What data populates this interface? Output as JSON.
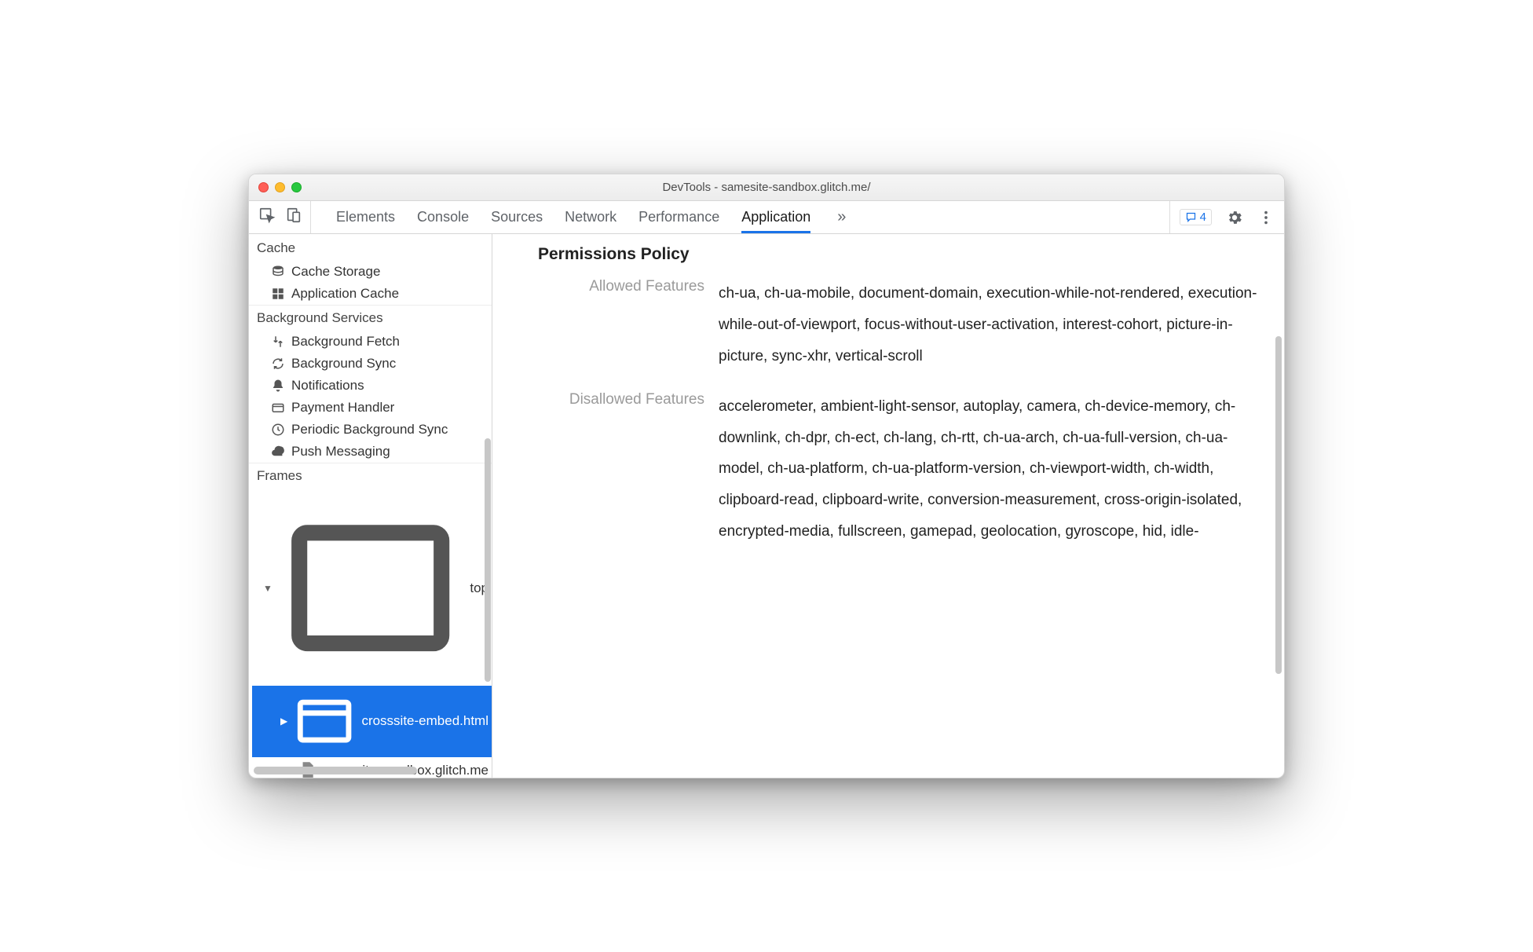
{
  "title": "DevTools - samesite-sandbox.glitch.me/",
  "tabs": [
    "Elements",
    "Console",
    "Sources",
    "Network",
    "Performance",
    "Application"
  ],
  "activeTab": "Application",
  "messageCount": "4",
  "sidebar": {
    "cache": {
      "title": "Cache",
      "items": [
        "Cache Storage",
        "Application Cache"
      ]
    },
    "bg": {
      "title": "Background Services",
      "items": [
        "Background Fetch",
        "Background Sync",
        "Notifications",
        "Payment Handler",
        "Periodic Background Sync",
        "Push Messaging"
      ]
    },
    "frames": {
      "title": "Frames",
      "top": "top",
      "selected": "crosssite-embed.html",
      "file": "samesite-sandbox.glitch.me"
    }
  },
  "content": {
    "heading": "Permissions Policy",
    "allowedLabel": "Allowed Features",
    "allowedValue": "ch-ua, ch-ua-mobile, document-domain, execution-while-not-rendered, execution-while-out-of-viewport, focus-without-user-activation, interest-cohort, picture-in-picture, sync-xhr, vertical-scroll",
    "disallowedLabel": "Disallowed Features",
    "disallowedValue": "accelerometer, ambient-light-sensor, autoplay, camera, ch-device-memory, ch-downlink, ch-dpr, ch-ect, ch-lang, ch-rtt, ch-ua-arch, ch-ua-full-version, ch-ua-model, ch-ua-platform, ch-ua-platform-version, ch-viewport-width, ch-width, clipboard-read, clipboard-write, conversion-measurement, cross-origin-isolated, encrypted-media, fullscreen, gamepad, geolocation, gyroscope, hid, idle-"
  }
}
